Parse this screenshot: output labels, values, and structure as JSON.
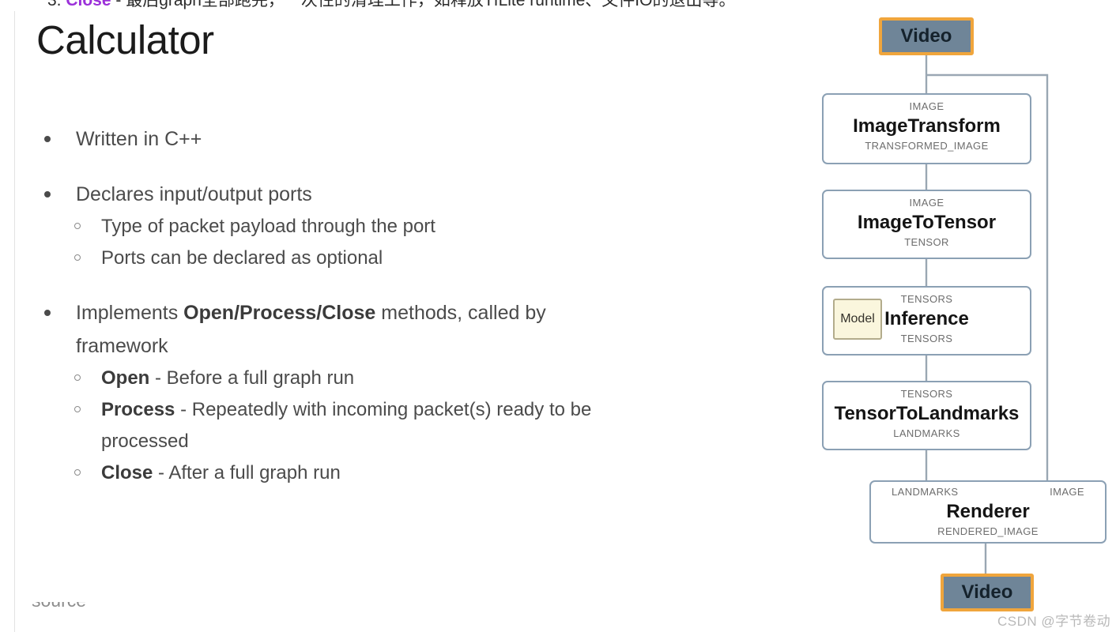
{
  "slide": {
    "cropped_header": {
      "prefix": "3. ",
      "keyword": "Close",
      "rest": " - 最后graph全部跑完，一次性的清理工作，如释放TfLite runtime、文件IO的退出等。"
    },
    "title": "Calculator",
    "footer_cropped": "source",
    "watermark": "CSDN @字节卷动"
  },
  "bullets": [
    {
      "level": 1,
      "text": "Written in C++"
    },
    {
      "level": 1,
      "text": "Declares input/output ports"
    },
    {
      "level": 2,
      "text": "Type of packet payload through the port"
    },
    {
      "level": 2,
      "text": "Ports can be declared as optional"
    },
    {
      "level": 1,
      "text": "Implements Open/Process/Close methods, called by framework",
      "bold_part": "Open/Process/Close",
      "lead": "Implements ",
      "tail": " methods, called by framework"
    },
    {
      "level": 2,
      "bold_part": "Open",
      "tail": " - Before a full graph run"
    },
    {
      "level": 2,
      "bold_part": "Process",
      "tail": " - Repeatedly with incoming packet(s) ready to be processed"
    },
    {
      "level": 2,
      "bold_part": "Close",
      "tail": " - After a full graph run"
    }
  ],
  "graph": {
    "io_nodes": [
      {
        "id": "video-in",
        "label": "Video"
      },
      {
        "id": "video-out",
        "label": "Video"
      }
    ],
    "calculators": [
      {
        "id": "image-transform",
        "name": "ImageTransform",
        "inputs": [
          "IMAGE"
        ],
        "outputs": [
          "TRANSFORMED_IMAGE"
        ]
      },
      {
        "id": "image-to-tensor",
        "name": "ImageToTensor",
        "inputs": [
          "IMAGE"
        ],
        "outputs": [
          "TENSOR"
        ]
      },
      {
        "id": "inference",
        "name": "Inference",
        "inputs": [
          "TENSORS"
        ],
        "outputs": [
          "TENSORS"
        ],
        "side_input": "Model"
      },
      {
        "id": "tensor-to-landmarks",
        "name": "TensorToLandmarks",
        "inputs": [
          "TENSORS"
        ],
        "outputs": [
          "LANDMARKS"
        ]
      },
      {
        "id": "renderer",
        "name": "Renderer",
        "inputs": [
          "LANDMARKS",
          "IMAGE"
        ],
        "outputs": [
          "RENDERED_IMAGE"
        ]
      }
    ],
    "colors": {
      "node_border": "#8ba0b4",
      "io_fill": "#6f8598",
      "io_border": "#f0a53c",
      "model_fill": "#faf6dd",
      "model_border": "#b3ac8c",
      "edge": "#9aa7b3"
    }
  }
}
